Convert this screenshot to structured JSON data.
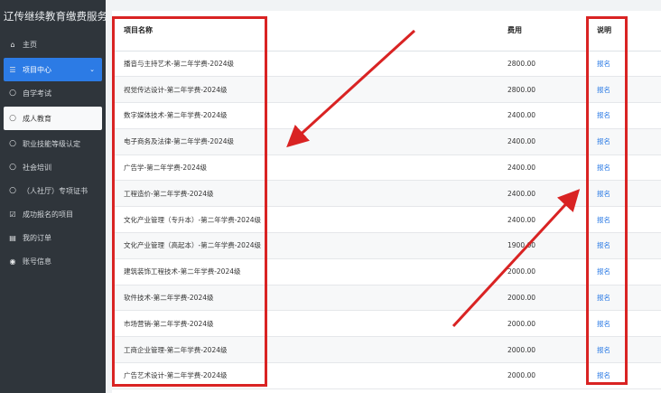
{
  "sidebar": {
    "title": "辽传继续教育缴费服务平台",
    "items": [
      {
        "label": "主页",
        "icon": "home-icon",
        "glyph": "⌂"
      },
      {
        "label": "项目中心",
        "icon": "list-icon",
        "glyph": "☰",
        "chevron": "⌄"
      },
      {
        "label": "自学考试",
        "icon": "circle-icon",
        "glyph": "○"
      },
      {
        "label": "成人教育",
        "icon": "circle-icon",
        "glyph": "○"
      },
      {
        "label": "职业技能等级认定",
        "icon": "circle-icon",
        "glyph": "○"
      },
      {
        "label": "社会培训",
        "icon": "circle-icon",
        "glyph": "○"
      },
      {
        "label": "（人社厅）专项证书",
        "icon": "circle-icon",
        "glyph": "○"
      },
      {
        "label": "成功报名的项目",
        "icon": "checkbox-icon",
        "glyph": "☑"
      },
      {
        "label": "我的订单",
        "icon": "file-icon",
        "glyph": "▤"
      },
      {
        "label": "账号信息",
        "icon": "user-icon",
        "glyph": "◉"
      }
    ]
  },
  "table": {
    "headers": {
      "name": "项目名称",
      "fee": "费用",
      "desc": "说明"
    },
    "rows": [
      {
        "name": "播音与主持艺术-第二年学费-2024级",
        "fee": "2800.00",
        "action": "报名"
      },
      {
        "name": "视觉传达设计-第二年学费-2024级",
        "fee": "2800.00",
        "action": "报名"
      },
      {
        "name": "数字媒体技术-第二年学费-2024级",
        "fee": "2400.00",
        "action": "报名"
      },
      {
        "name": "电子商务及法律-第二年学费-2024级",
        "fee": "2400.00",
        "action": "报名"
      },
      {
        "name": "广告学-第二年学费-2024级",
        "fee": "2400.00",
        "action": "报名"
      },
      {
        "name": "工程造价-第二年学费-2024级",
        "fee": "2400.00",
        "action": "报名"
      },
      {
        "name": "文化产业管理（专升本）-第二年学费-2024级",
        "fee": "2400.00",
        "action": "报名"
      },
      {
        "name": "文化产业管理（高起本）-第二年学费-2024级",
        "fee": "1900.00",
        "action": "报名"
      },
      {
        "name": "建筑装饰工程技术-第二年学费-2024级",
        "fee": "2000.00",
        "action": "报名"
      },
      {
        "name": "软件技术-第二年学费-2024级",
        "fee": "2000.00",
        "action": "报名"
      },
      {
        "name": "市场营销-第二年学费-2024级",
        "fee": "2000.00",
        "action": "报名"
      },
      {
        "name": "工商企业管理-第二年学费-2024级",
        "fee": "2000.00",
        "action": "报名"
      },
      {
        "name": "广告艺术设计-第二年学费-2024级",
        "fee": "2000.00",
        "action": "报名"
      }
    ]
  },
  "colors": {
    "accent": "#2c7be5",
    "sidebar": "#2f353b",
    "annotation": "#d92323"
  }
}
